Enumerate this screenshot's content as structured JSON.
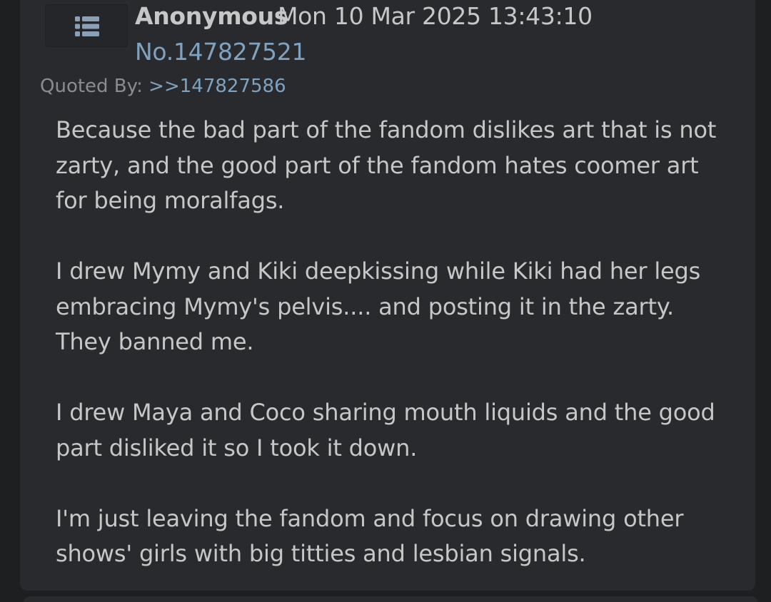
{
  "post": {
    "author": "Anonymous",
    "datetime": "Mon 10 Mar 2025 13:43:10",
    "number": "No.147827521",
    "quoted_by_label": "Quoted By:",
    "quoted_by_link": ">>147827586",
    "paragraphs": [
      "Because the bad part of the fandom dislikes art that is not zarty, and the good part of the fandom hates coomer art for being moralfags.",
      "I drew Mymy and Kiki deepkissing while Kiki had her legs embracing Mymy's pelvis.... and posting it in the zarty. They banned me.",
      "I drew Maya and Coco sharing mouth liquids and the good part disliked it so I took it down.",
      "I'm just leaving the fandom and focus on drawing other shows' girls with big titties and lesbian signals."
    ],
    "menu_icon": "list-menu-icon"
  },
  "colors": {
    "background": "#1d1f21",
    "post_background": "#282a2e",
    "text": "#c5c8c6",
    "link": "#81a2be",
    "muted": "#8a8d8f"
  }
}
